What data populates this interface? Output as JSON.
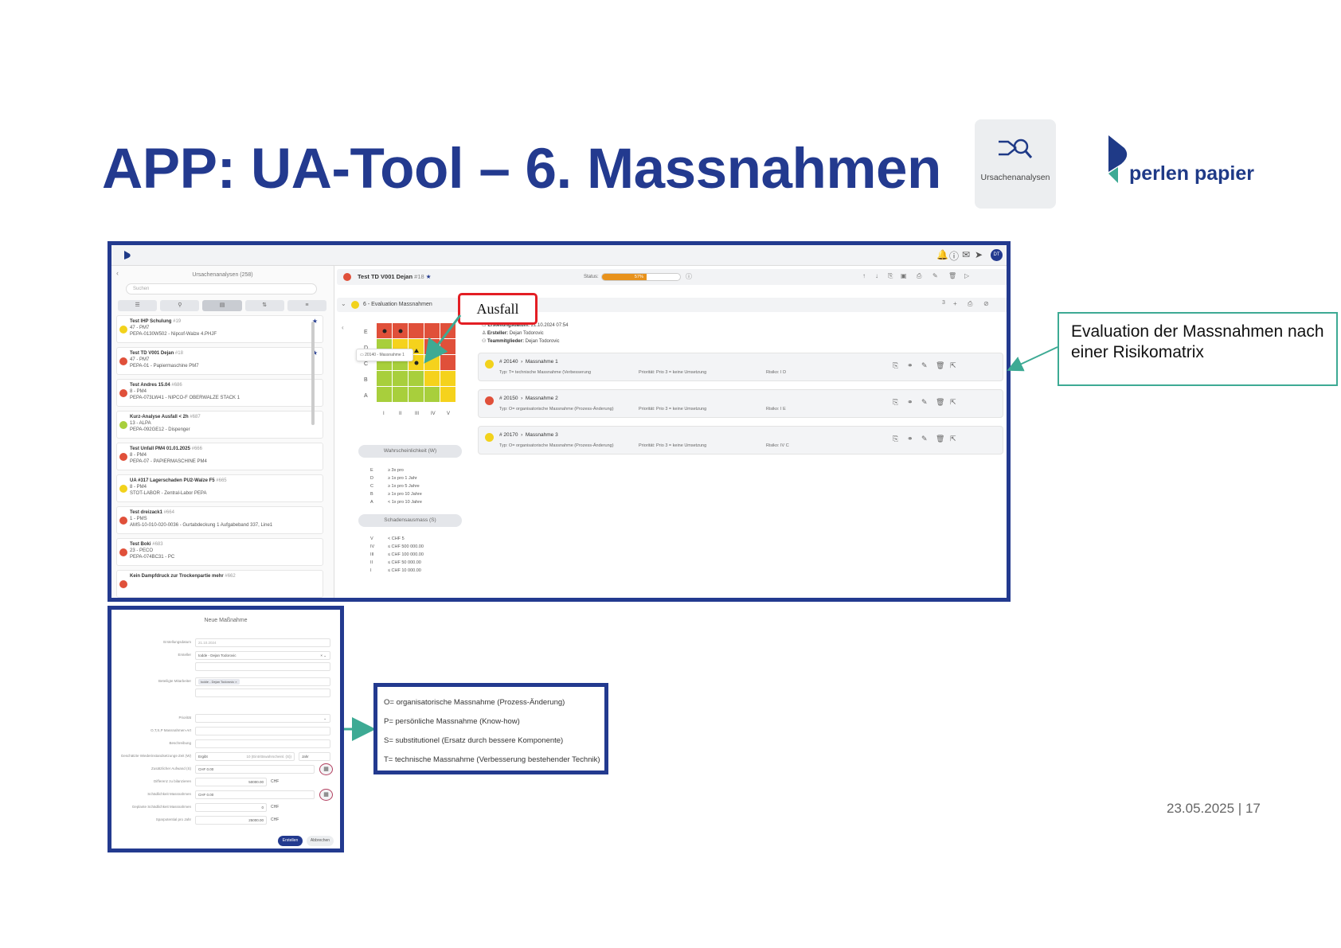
{
  "slide": {
    "title": "APP: UA-Tool – 6. Massnahmen",
    "app_tile_label": "Ursachenanalysen",
    "logo_text": "perlen papier",
    "callout_text": "Evaluation der Massnahmen nach einer Risikomatrix",
    "date_page": "23.05.2025 | 17",
    "ausfall_label": "Ausfall",
    "colors": {
      "title": "#233a8f",
      "frame": "#233a8f",
      "callout_border": "#3daa94",
      "ausfall_border": "#e31e24"
    }
  },
  "app": {
    "topbar_badge": "DT",
    "left": {
      "title": "Ursachenanalysen (258)",
      "search_placeholder": "Suchen",
      "tools": [
        "☰",
        "⚲",
        "▤",
        "⇅",
        "≡"
      ],
      "items": [
        {
          "title": "Test IHP Schulung",
          "num": "#19",
          "l1": "47 - PM7",
          "l2": "PEPA-0130W502 - Nipcof-Walze 4.PHJF",
          "color": "#f2d21c",
          "star": "★"
        },
        {
          "title": "Test TD V001 Dejan",
          "num": "#18",
          "l1": "47 - PM7",
          "l2": "PEPA-01 - Papiermaschine PM7",
          "color": "#e0503a",
          "star": "★"
        },
        {
          "title": "Test Andres 15.04",
          "num": "#686",
          "l1": "8 - PM4",
          "l2": "PEPA-073LW41 - NIPCO-F OBERWALZE STACK 1",
          "color": "#e0503a",
          "star": ""
        },
        {
          "title": "Kurz-Analyse Ausfall < 2h",
          "num": "#687",
          "l1": "13 - ALPA",
          "l2": "PEPA-092GE12 - Dispenger",
          "color": "#a8cf3c",
          "star": ""
        },
        {
          "title": "Test Unfall PM4 01.01.2025",
          "num": "#666",
          "l1": "8 - PM4",
          "l2": "PEPA-07 - PAPIERMASCHINE PM4",
          "color": "#e0503a",
          "star": ""
        },
        {
          "title": "UA #317 Lagerschaden PU2-Walze F5",
          "num": "#665",
          "l1": "8 - PM4",
          "l2": "STOT-LABOR - Zentral-Labor PEPA",
          "color": "#f2d21c",
          "star": ""
        },
        {
          "title": "Test dreizack1",
          "num": "#664",
          "l1": "1 - PMS",
          "l2": "AMS-10-010-020-0036 - Gurtabdeckung 1 Aufgabeband 337, Line1",
          "color": "#e0503a",
          "star": ""
        },
        {
          "title": "Test Boki",
          "num": "#683",
          "l1": "23 - PECO",
          "l2": "PEPA-074BC31 - PC",
          "color": "#e0503a",
          "star": ""
        },
        {
          "title": "Kein Dampfdruck zur Trockenpartie mehr",
          "num": "#662",
          "l1": "",
          "l2": "",
          "color": "#e0503a",
          "star": ""
        }
      ]
    },
    "header": {
      "name": "Test TD V001 Dejan",
      "num": "#18",
      "star": "★",
      "status_label": "Status:",
      "progress_text": "57%",
      "progress": 0.57
    },
    "section": {
      "label": "6 - Evaluation Massnahmen",
      "count": "3"
    },
    "matrix": {
      "rows": [
        "E",
        "D",
        "C",
        "B",
        "A"
      ],
      "cols": [
        "I",
        "II",
        "III",
        "IV",
        "V"
      ],
      "colors": {
        "red": "#e0503a",
        "yellow": "#f5d21c",
        "green": "#a8cf3c"
      },
      "grid": [
        [
          "red",
          "red",
          "red",
          "red",
          "red"
        ],
        [
          "green",
          "yellow",
          "yellow",
          "red",
          "red"
        ],
        [
          "green",
          "green",
          "yellow",
          "yellow",
          "red"
        ],
        [
          "green",
          "green",
          "green",
          "yellow",
          "yellow"
        ],
        [
          "green",
          "green",
          "green",
          "green",
          "yellow"
        ]
      ],
      "tooltip": "20140 - Massnahme 1",
      "w_label": "Wahrscheinlichkeit (W)",
      "w_scale": [
        [
          "E",
          "≥ 3x pro"
        ],
        [
          "D",
          "≥ 1x pro 1 Jahr"
        ],
        [
          "C",
          "≥ 1x pro 5 Jahre"
        ],
        [
          "B",
          "≥ 1x pro 10 Jahre"
        ],
        [
          "A",
          "< 1x pro 10 Jahre"
        ]
      ],
      "s_label": "Schadensausmass (S)",
      "s_scale": [
        [
          "V",
          "< CHF 5"
        ],
        [
          "IV",
          "≤ CHF 500 000.00"
        ],
        [
          "III",
          "≤ CHF 100 000.00"
        ],
        [
          "II",
          "≤ CHF 50 000.00"
        ],
        [
          "I",
          "≤ CHF 10 000.00"
        ]
      ]
    },
    "meta": {
      "created_label": "Erstellungsdatum:",
      "created": "21.10.2024 07:54",
      "creator_label": "Ersteller:",
      "creator": "Dejan Todorovic",
      "team_label": "Teammitglieder:",
      "team": "Dejan Todorovic"
    },
    "measures": [
      {
        "id": "20140",
        "name": "Massnahme 1",
        "typ": "Typ: T= technische Massnahme (Verbesserung",
        "prio": "Priorität: Prio 3 = keine Umsetzung",
        "risk": "Risiko: I D",
        "color": "#f2d21c"
      },
      {
        "id": "20150",
        "name": "Massnahme 2",
        "typ": "Typ: O= organisatorische Massnahme (Prozess-Änderung)",
        "prio": "Priorität: Prio 3 = keine Umsetzung",
        "risk": "Risiko: I E",
        "color": "#e0503a"
      },
      {
        "id": "20170",
        "name": "Massnahme 3",
        "typ": "Typ: O= organisatorische Massnahme (Prozess-Änderung)",
        "prio": "Priorität: Prio 3 = keine Umsetzung",
        "risk": "Risiko: IV C",
        "color": "#f2d21c"
      }
    ]
  },
  "form": {
    "title": "Neue Maßnahme",
    "created_label": "Erstellungsdatum",
    "created_value": "21.10.2024",
    "creator_label": "Ersteller",
    "creator_value": "todde - Dejan Todorovic",
    "members_label": "Beteiligte Mitarbeiter",
    "members_chip": "todde - Dejan Todorovic ×",
    "priority_label": "Priorität",
    "type_label": "O,T,S,P Massnahmen-Art",
    "desc_label": "Beschreibung",
    "cost_label": "Geschätzte Wiederinstandsetzungs-Zeit (W)",
    "cost_scale": "Ergibt",
    "cost_prob": "10 (Eintrittswahrscheinl. (S))",
    "cost_unit": "Jahr",
    "extra_label": "Zusätzlicher Aufwand (S)",
    "extra_value": "CHF 0.00",
    "diff_label": "Differenz zu bilanzieren",
    "diff_value": "50000.00",
    "diff_unit": "CHF",
    "harm_label": "Schädlichkeit Massnahmen",
    "harm_value": "CHF 0.00",
    "harm2_label": "Geplante Schädlichkeit Massnahmen",
    "harm2_value": "0",
    "harm2_unit": "CHF",
    "save_label": "Sparpotential pro Jahr",
    "save_value": "25000.00",
    "save_unit": "CHF",
    "create_btn": "Erstellen",
    "cancel_btn": "Abbrechen"
  },
  "legend": {
    "items": [
      "O= organisatorische Massnahme (Prozess-Änderung)",
      "P= persönliche Massnahme (Know-how)",
      "S= substitutionel (Ersatz durch bessere Komponente)",
      "T= technische Massnahme (Verbesserung bestehender Technik)"
    ]
  }
}
